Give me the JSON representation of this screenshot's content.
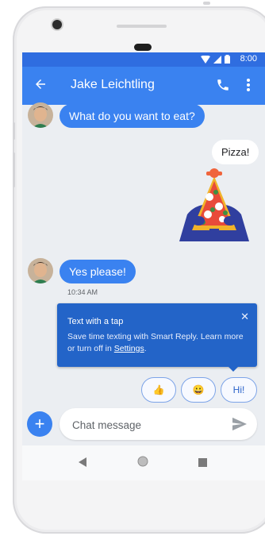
{
  "status_bar": {
    "time": "8:00"
  },
  "app_bar": {
    "contact_name": "Jake Leichtling",
    "back_icon": "arrow-back-icon",
    "call_icon": "phone-icon",
    "menu_icon": "more-vert-icon"
  },
  "messages": [
    {
      "direction": "incoming",
      "text": "What do you want to eat?"
    },
    {
      "direction": "outgoing",
      "text": "Pizza!"
    },
    {
      "direction": "outgoing",
      "type": "sticker",
      "sticker": "pizza-sticker-icon"
    },
    {
      "direction": "incoming",
      "text": "Yes please!",
      "timestamp": "10:34 AM"
    }
  ],
  "tooltip": {
    "title": "Text with a tap",
    "body": "Save time texting with Smart Reply. Learn more or turn off in ",
    "link": "Settings",
    "end": "."
  },
  "smart_replies": [
    "👍",
    "😀",
    "Hi!"
  ],
  "compose": {
    "placeholder": "Chat message",
    "add_icon": "add-icon",
    "send_icon": "send-icon"
  },
  "colors": {
    "accent": "#3a82f0",
    "status_bar": "#2f6de0",
    "tooltip": "#2364c8",
    "background": "#ebeef2"
  }
}
